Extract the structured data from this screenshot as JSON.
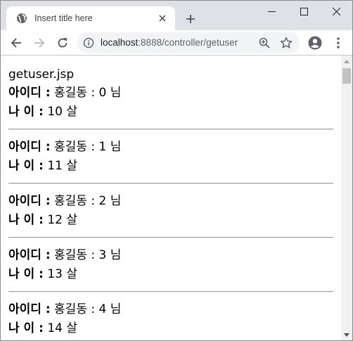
{
  "tab": {
    "title": "Insert title here"
  },
  "address_bar": {
    "host": "localhost",
    "rest": ":8888/controller/getuser"
  },
  "page": {
    "heading": "getuser.jsp",
    "id_label": "아이디 :",
    "age_label": "나 이 :",
    "users": [
      {
        "id": "홍길동 : 0 님",
        "age": "10 살"
      },
      {
        "id": "홍길동 : 1 님",
        "age": "11 살"
      },
      {
        "id": "홍길동 : 2 님",
        "age": "12 살"
      },
      {
        "id": "홍길동 : 3 님",
        "age": "13 살"
      },
      {
        "id": "홍길동 : 4 님",
        "age": "14 살"
      }
    ]
  },
  "colors": {
    "tabstrip": "#dee1e6",
    "omnibox": "#f1f3f4",
    "icon": "#5f6368"
  },
  "icons": [
    "globe-icon",
    "close-icon",
    "plus-icon",
    "minimize-icon",
    "maximize-icon",
    "window-close-icon",
    "back-arrow-icon",
    "forward-arrow-icon",
    "reload-icon",
    "info-icon",
    "zoom-icon",
    "star-icon",
    "account-icon",
    "kebab-menu-icon"
  ]
}
